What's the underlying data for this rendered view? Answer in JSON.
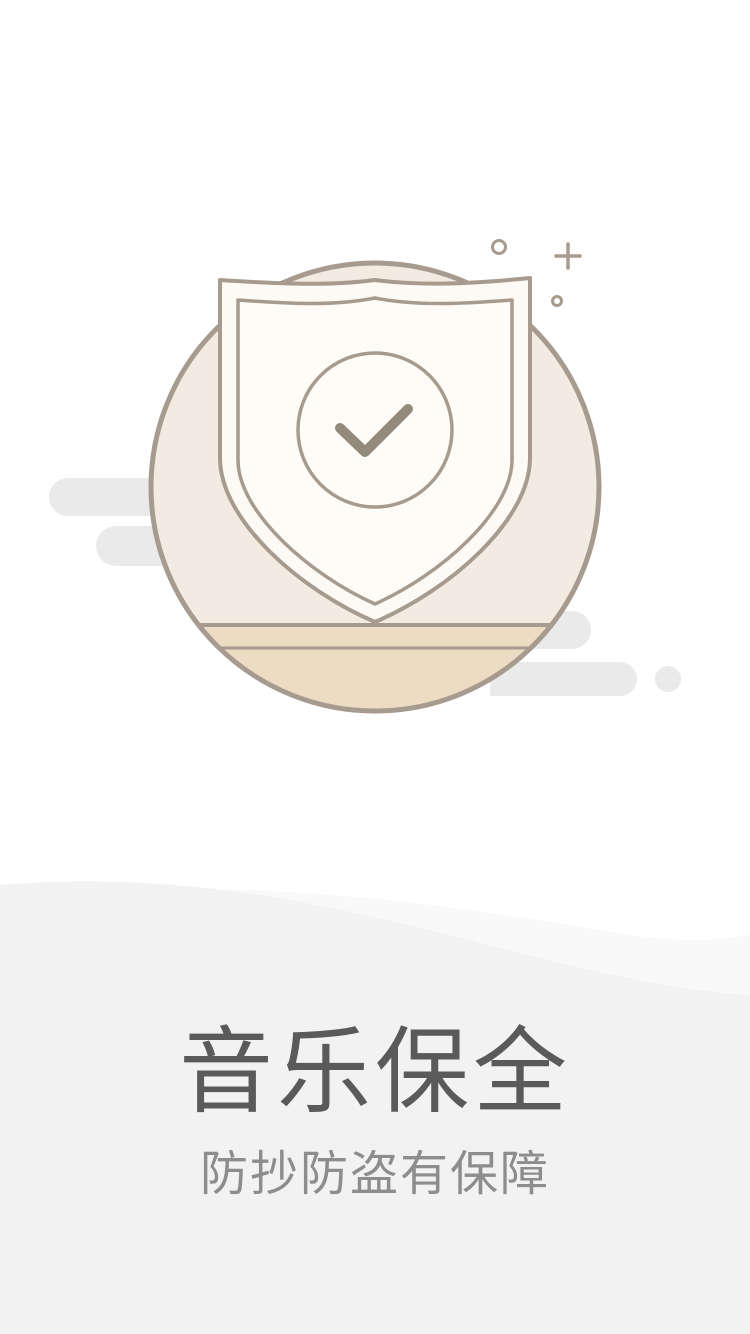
{
  "page": {
    "title": "音乐保全",
    "subtitle": "防抄防盗有保障"
  },
  "colors": {
    "background": "#ffffff",
    "wave_light": "#f9f9f9",
    "wave_dark": "#f2f2f2",
    "cloud": "#eaeaea",
    "circle_fill": "#f3ebe1",
    "circle_stroke": "#a69b8e",
    "ground_fill": "#ecdcc4",
    "shield_fill": "#fdf9f5",
    "check_stroke": "#938a7c",
    "title_text": "#5a5a5a",
    "subtitle_text": "#8d8d8d"
  },
  "icons": {
    "hero": "shield-check-icon"
  }
}
